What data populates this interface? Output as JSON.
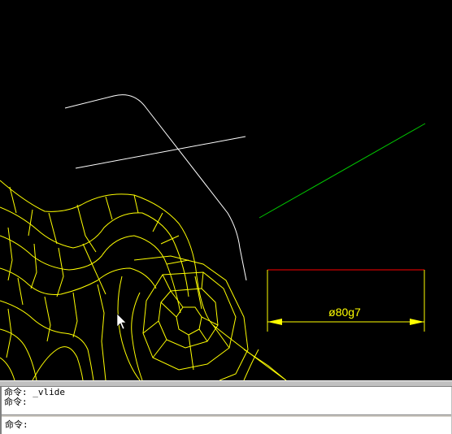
{
  "drawing": {
    "dimension_text": "ø80g7"
  },
  "command": {
    "history": [
      "命令: _vlide",
      "命令:"
    ],
    "prompt": "命令:"
  },
  "colors": {
    "background": "#000000",
    "contour": "#ffff00",
    "white_line": "#ffffff",
    "green_line": "#00c800",
    "red_line": "#ff0000",
    "dimension": "#ffff00"
  }
}
